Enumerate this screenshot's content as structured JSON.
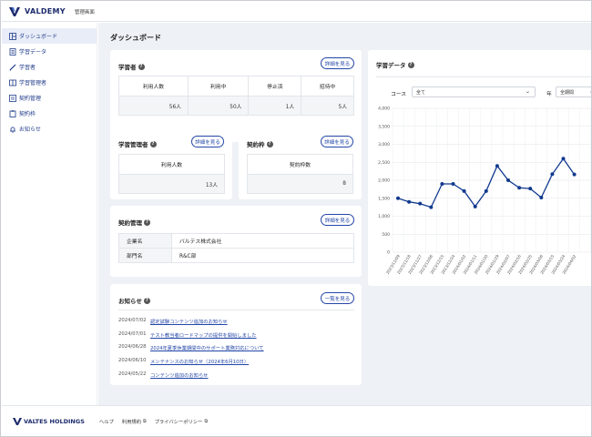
{
  "header": {
    "brand": "VALDEMY",
    "admin_label": "管理画面"
  },
  "sidebar": {
    "items": [
      {
        "label": "ダッシュボード",
        "icon": "dashboard-icon"
      },
      {
        "label": "学習データ",
        "icon": "document-icon"
      },
      {
        "label": "学習者",
        "icon": "pencil-icon"
      },
      {
        "label": "学習管理者",
        "icon": "book-icon"
      },
      {
        "label": "契約管理",
        "icon": "contract-icon"
      },
      {
        "label": "契約枠",
        "icon": "clipboard-icon"
      },
      {
        "label": "お知らせ",
        "icon": "bell-icon"
      }
    ]
  },
  "page": {
    "title": "ダッシュボード"
  },
  "learners": {
    "title": "学習者",
    "button": "詳細を見る",
    "headers": [
      "利用人数",
      "利用中",
      "停止済",
      "招待中"
    ],
    "values": [
      "56人",
      "50人",
      "1人",
      "5人"
    ]
  },
  "managers": {
    "title": "学習管理者",
    "button": "詳細を見る",
    "header": "利用人数",
    "value": "13人"
  },
  "quota": {
    "title": "契約枠",
    "button": "詳細を見る",
    "header": "契約枠数",
    "value": "8"
  },
  "contract": {
    "title": "契約管理",
    "button": "詳細を見る",
    "rows": [
      {
        "key": "企業名",
        "value": "バルテス株式会社"
      },
      {
        "key": "部門名",
        "value": "R&C部"
      }
    ]
  },
  "news": {
    "title": "お知らせ",
    "button": "一覧を見る",
    "items": [
      {
        "date": "2024/07/02",
        "text": "認定試験コンテンツ追加のお知らせ"
      },
      {
        "date": "2024/07/01",
        "text": "テスト教当者ロードマップの提供を開始しました"
      },
      {
        "date": "2024/06/28",
        "text": "2024年夏季休業期間中のサポート業務対応について"
      },
      {
        "date": "2024/06/10",
        "text": "メンテナンスのお知らせ（2024年6月10日）"
      },
      {
        "date": "2024/05/22",
        "text": "コンテンツ追加のお知らせ"
      }
    ]
  },
  "learning_data": {
    "title": "学習データ",
    "course_label": "コース",
    "course_value": "全て",
    "year_label": "年",
    "year_value": "全期間"
  },
  "chart_data": {
    "type": "line",
    "x": [
      "2023/11/09",
      "2023/11/18",
      "2023/11/27",
      "2023/12/06",
      "2023/12/15",
      "2023/12/24",
      "2024/01/02",
      "2024/01/11",
      "2024/01/20",
      "2024/01/29",
      "2024/02/07",
      "2024/02/16",
      "2024/02/25",
      "2024/03/06",
      "2024/03/15",
      "2024/03/24",
      "2024/04/02"
    ],
    "series": [
      {
        "values": [
          1500,
          1400,
          1350,
          1250,
          1900,
          1900,
          1700,
          1270,
          1700,
          2400,
          2000,
          1790,
          1770,
          1520,
          2170,
          2600,
          2160
        ]
      }
    ],
    "yticks": [
      "4,000",
      "3,500",
      "3,000",
      "2,500",
      "2,000",
      "1,500",
      "1,000",
      "500",
      "0"
    ],
    "ylim": [
      0,
      4000
    ],
    "grid": true,
    "color": "#123a8f"
  },
  "footer": {
    "brand": "VALTES HOLDINGS",
    "links": [
      "ヘルプ",
      "利用規約",
      "プライバシーポリシー"
    ]
  }
}
